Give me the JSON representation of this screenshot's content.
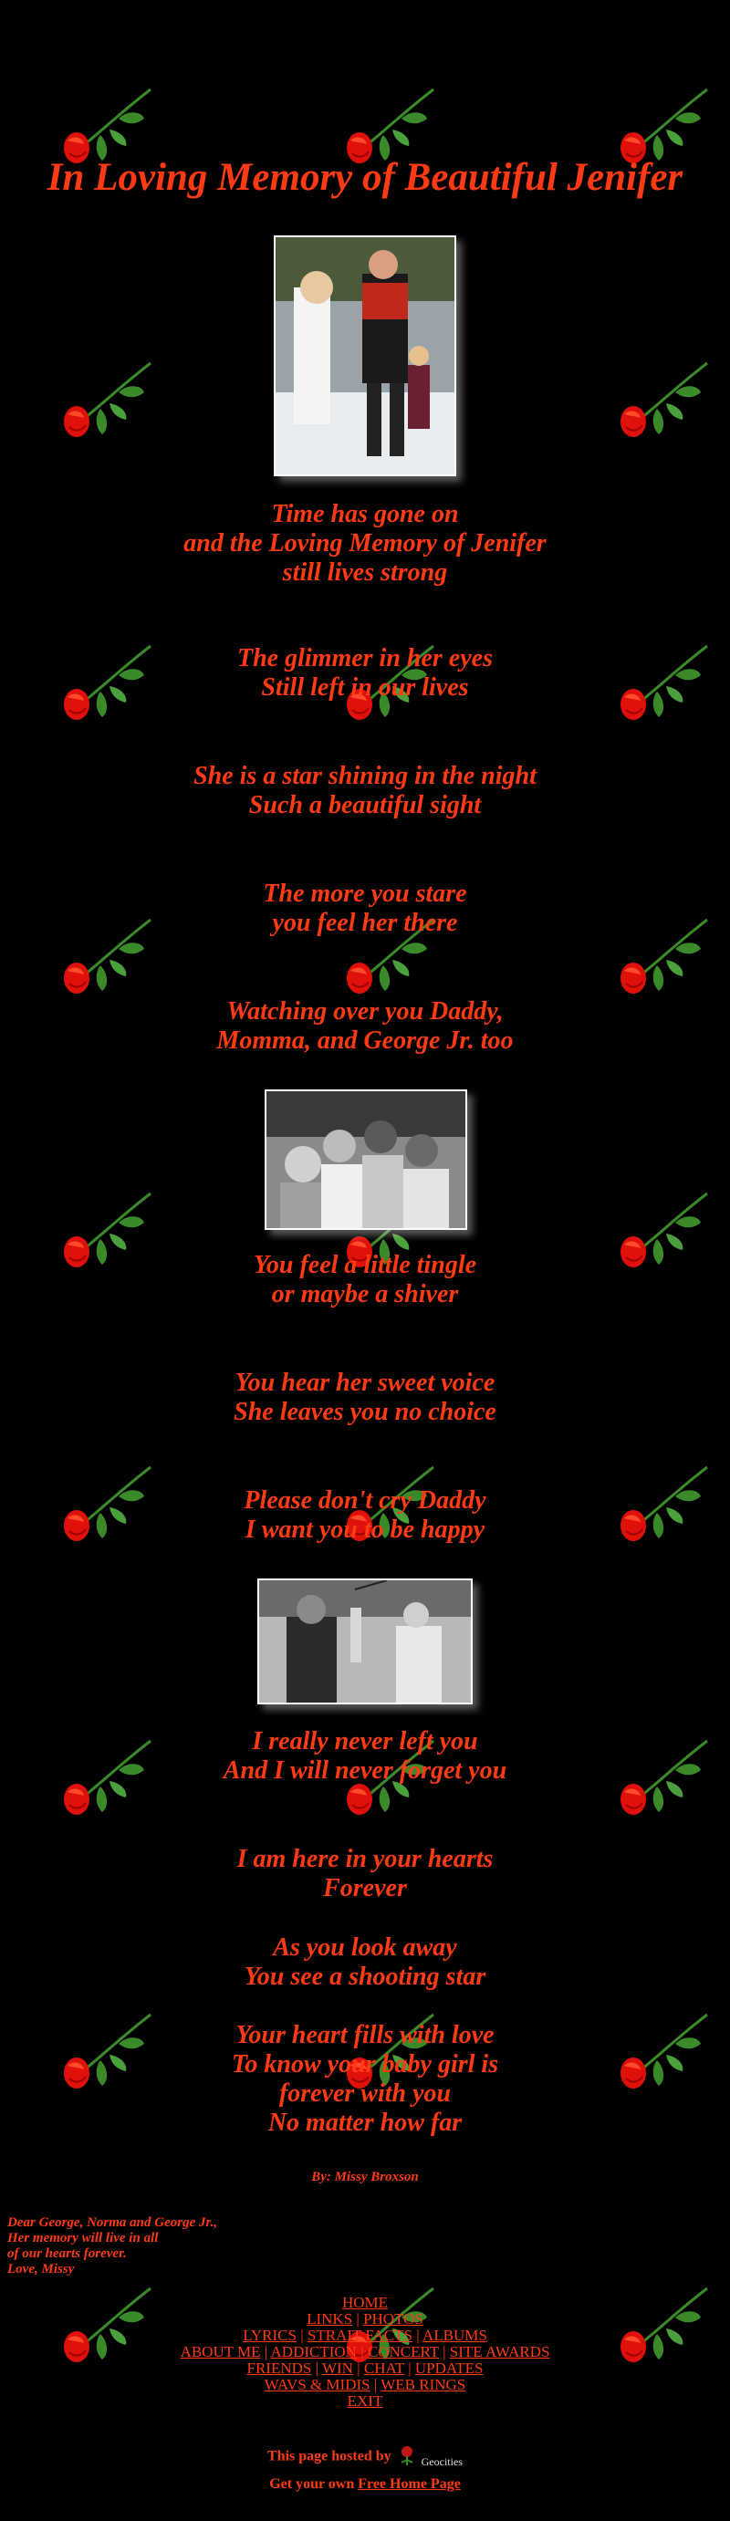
{
  "title": "In Loving Memory of Beautiful Jenifer",
  "stanzas": [
    {
      "lines": [
        "Time has gone on",
        "and the Loving Memory of Jenifer",
        "still lives strong"
      ]
    },
    {
      "lines": [
        "The glimmer in her eyes",
        "Still left in our lives"
      ]
    },
    {
      "lines": [
        "She is a star shining in the night",
        "Such a beautiful sight"
      ]
    },
    {
      "lines": [
        "The more you stare",
        "you feel her there"
      ]
    },
    {
      "lines": [
        "Watching over you Daddy,",
        "Momma, and George Jr. too"
      ]
    },
    {
      "lines": [
        "You feel a little tingle",
        "or maybe a shiver"
      ]
    },
    {
      "lines": [
        "You hear her sweet voice",
        "She leaves you no choice"
      ]
    },
    {
      "lines": [
        "Please don't cry Daddy",
        "I want you to be happy"
      ]
    },
    {
      "lines": [
        "I really never left you",
        "And I will never forget you"
      ]
    },
    {
      "lines": [
        "I am here in your hearts",
        "Forever"
      ]
    },
    {
      "lines": [
        "As you look away",
        "You see a shooting star"
      ]
    },
    {
      "lines": [
        "Your heart fills with love",
        "To know your baby girl is",
        "forever with you",
        "No matter how far"
      ]
    }
  ],
  "author": "By: Missy Broxson",
  "letter": [
    "Dear George, Norma and George Jr.,",
    "Her memory will live in all",
    "of our hearts forever.",
    "Love, Missy"
  ],
  "nav": {
    "rows": [
      [
        "HOME"
      ],
      [
        "LINKS",
        "PHOTOS"
      ],
      [
        "LYRICS",
        "STRAIT FACTS",
        "ALBUMS"
      ],
      [
        "ABOUT ME",
        "ADDICTION",
        "CONCERT",
        "SITE AWARDS"
      ],
      [
        "FRIENDS",
        "WIN",
        "CHAT",
        "UPDATES"
      ],
      [
        "WAVS & MIDIS",
        "WEB RINGS"
      ],
      [
        "EXIT"
      ]
    ]
  },
  "footer": {
    "hosted_text": "This page hosted by",
    "host_name": "Geocities",
    "get_own_prefix": "Get your own",
    "get_own_link": "Free Home Page"
  },
  "colors": {
    "text": "#ff3a14",
    "background": "#000000",
    "rose": "#e0100a",
    "leaf": "#3a8a2a"
  }
}
